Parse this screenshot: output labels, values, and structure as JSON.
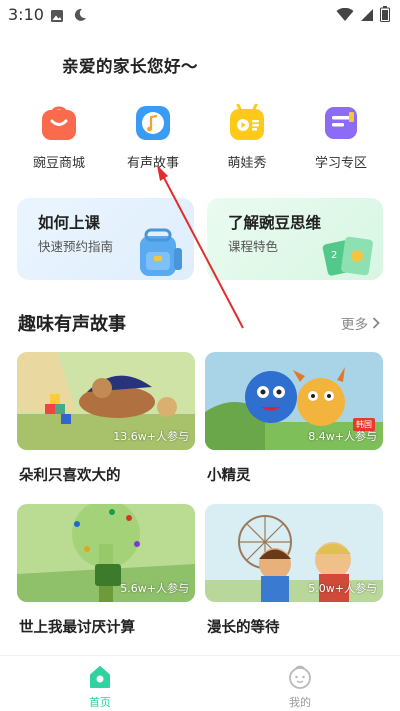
{
  "status_bar": {
    "time": "3:10"
  },
  "greeting": "亲爱的家长您好～",
  "quick_menu": [
    {
      "label": "豌豆商城",
      "icon": "shopping-bag-icon",
      "color": "#fa6a4c"
    },
    {
      "label": "有声故事",
      "icon": "music-note-icon",
      "color": "#3a9bf5"
    },
    {
      "label": "萌娃秀",
      "icon": "video-play-icon",
      "color": "#ffc91a"
    },
    {
      "label": "学习专区",
      "icon": "study-book-icon",
      "color": "#8d6cf5"
    }
  ],
  "promos": [
    {
      "title": "如何上课",
      "subtitle": "快速预约指南"
    },
    {
      "title": "了解豌豆思维",
      "subtitle": "课程特色"
    }
  ],
  "section": {
    "title": "趣味有声故事",
    "more_label": "更多"
  },
  "stories": [
    {
      "name": "朵利只喜欢大的",
      "count": "13.6w+人参与"
    },
    {
      "name": "小精灵",
      "count": "8.4w+人参与",
      "tag": "韩国"
    },
    {
      "name": "世上我最讨厌计算",
      "count": "5.6w+人参与"
    },
    {
      "name": "漫长的等待",
      "count": "5.0w+人参与"
    }
  ],
  "bottom_nav": [
    {
      "label": "首页",
      "active": true
    },
    {
      "label": "我的",
      "active": false
    }
  ],
  "colors": {
    "accent": "#2ed3a0",
    "annotation": "#e02d2d"
  }
}
